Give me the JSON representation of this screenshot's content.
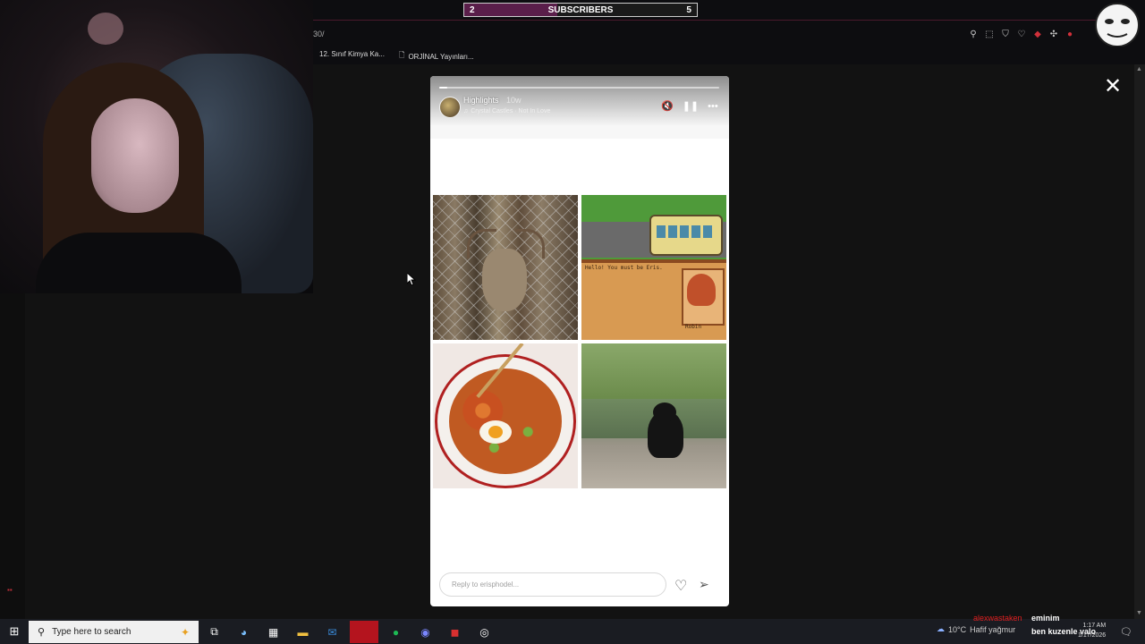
{
  "overlay": {
    "subscribers": {
      "left": "2",
      "label": "SUBSCRIBERS",
      "right": "5",
      "fill_fraction": 0.4
    }
  },
  "browser": {
    "url_fragment": "30/",
    "bookmarks": [
      {
        "label": "12. Sınıf Kimya Ka..."
      },
      {
        "label": "ORJİNAL Yayınları..."
      }
    ],
    "toolbar_icons": [
      "pin-icon",
      "screenshot-icon",
      "shield-icon",
      "heart-icon",
      "extension-red-icon",
      "puzzle-icon",
      "profile-icon"
    ]
  },
  "story": {
    "title": "Highlights",
    "time": "10w",
    "song": "Crystal Castles · Not In Love",
    "progress_fraction": 0.03,
    "reply_placeholder": "Reply to erisphodel...",
    "photos": [
      "deer-photo",
      "stardew-game-screenshot",
      "ramen-bowl-photo",
      "black-cat-photo"
    ],
    "game_text": "Hello! You must be Eris.",
    "game_name": "Robin"
  },
  "taskbar": {
    "search_placeholder": "Type here to search",
    "weather": "10°C",
    "weather_text": "Hafif yağmur",
    "clock_time": "1:17 AM",
    "clock_date": "1/17/2026"
  },
  "chat": {
    "user1": "alexwastaken",
    "msg1": "eminim",
    "msg2": "ben kuzenle valo"
  },
  "colors": {
    "accent_red": "#b4141e",
    "subscriber_fill": "#5a1e4a"
  }
}
